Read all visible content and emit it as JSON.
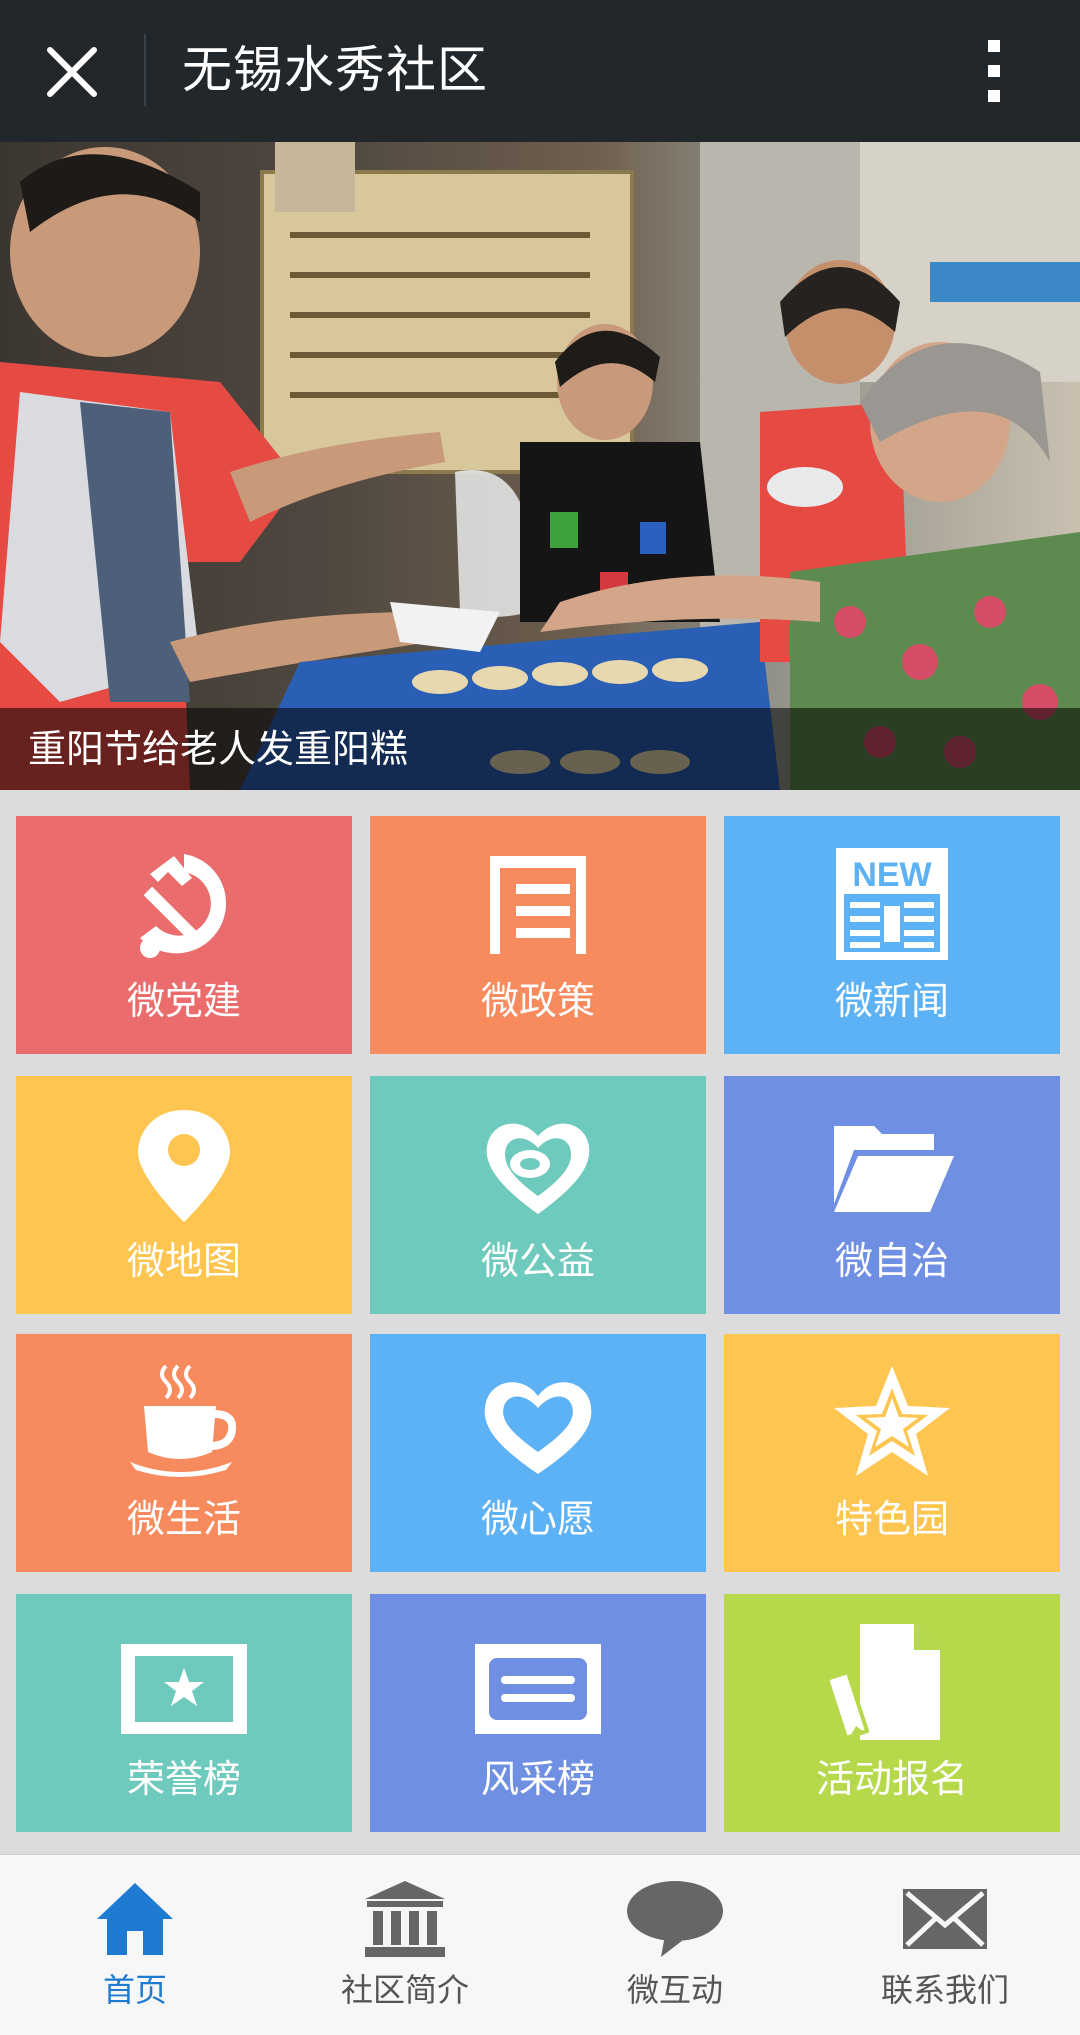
{
  "header": {
    "title": "无锡水秀社区",
    "close_icon": "close-icon",
    "more_icon": "more-vertical-icon"
  },
  "banner": {
    "caption": "重阳节给老人发重阳糕"
  },
  "tiles": [
    {
      "label": "微党建",
      "icon": "hammer-sickle-icon",
      "color": "#eb6c6c"
    },
    {
      "label": "微政策",
      "icon": "document-list-icon",
      "color": "#f78b5e"
    },
    {
      "label": "微新闻",
      "icon": "newspaper-icon",
      "color": "#5db1f5",
      "icon_text": "NEW"
    },
    {
      "label": "微地图",
      "icon": "map-pin-icon",
      "color": "#fec650"
    },
    {
      "label": "微公益",
      "icon": "charity-heart-icon",
      "color": "#6fcabe"
    },
    {
      "label": "微自治",
      "icon": "folder-icon",
      "color": "#6f8fe3"
    },
    {
      "label": "微生活",
      "icon": "coffee-cup-icon",
      "color": "#f78b5e"
    },
    {
      "label": "微心愿",
      "icon": "heart-icon",
      "color": "#5db1f5"
    },
    {
      "label": "特色园",
      "icon": "star-icon",
      "color": "#fec650"
    },
    {
      "label": "荣誉榜",
      "icon": "certificate-star-icon",
      "color": "#6fcabe"
    },
    {
      "label": "风采榜",
      "icon": "card-lines-icon",
      "color": "#6f8fe3"
    },
    {
      "label": "活动报名",
      "icon": "document-pencil-icon",
      "color": "#b6d94b"
    }
  ],
  "bottom_nav": [
    {
      "label": "首页",
      "icon": "home-icon",
      "active": true
    },
    {
      "label": "社区简介",
      "icon": "bank-building-icon",
      "active": false
    },
    {
      "label": "微互动",
      "icon": "chat-bubble-icon",
      "active": false
    },
    {
      "label": "联系我们",
      "icon": "envelope-icon",
      "active": false
    }
  ],
  "colors": {
    "active_nav": "#1f7bd1",
    "inactive_nav": "#555555",
    "topbar": "#21272b"
  }
}
